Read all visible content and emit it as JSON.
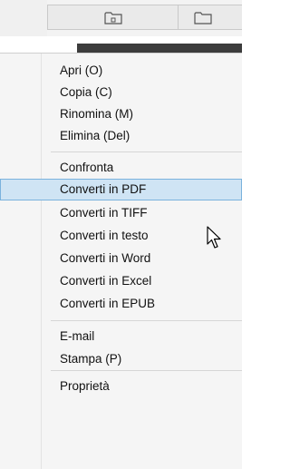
{
  "toolbar": {
    "buttons": [
      {
        "icon": "folder-icon"
      },
      {
        "icon": "folder-icon"
      }
    ]
  },
  "menu": {
    "groups": [
      {
        "items": [
          "Apri (O)",
          "Copia (C)",
          "Rinomina (M)",
          "Elimina (Del)"
        ]
      },
      {
        "items": [
          "Confronta",
          "Converti in PDF",
          "Converti in TIFF",
          "Converti in testo",
          "Converti in Word",
          "Converti in Excel",
          "Converti in EPUB"
        ]
      },
      {
        "items": [
          "E-mail",
          "Stampa (P)"
        ]
      },
      {
        "items": [
          "Proprietà"
        ]
      }
    ],
    "highlighted": "Converti in PDF"
  },
  "colors": {
    "highlight_bg": "#cfe4f4",
    "highlight_border": "#7ab2dd"
  }
}
